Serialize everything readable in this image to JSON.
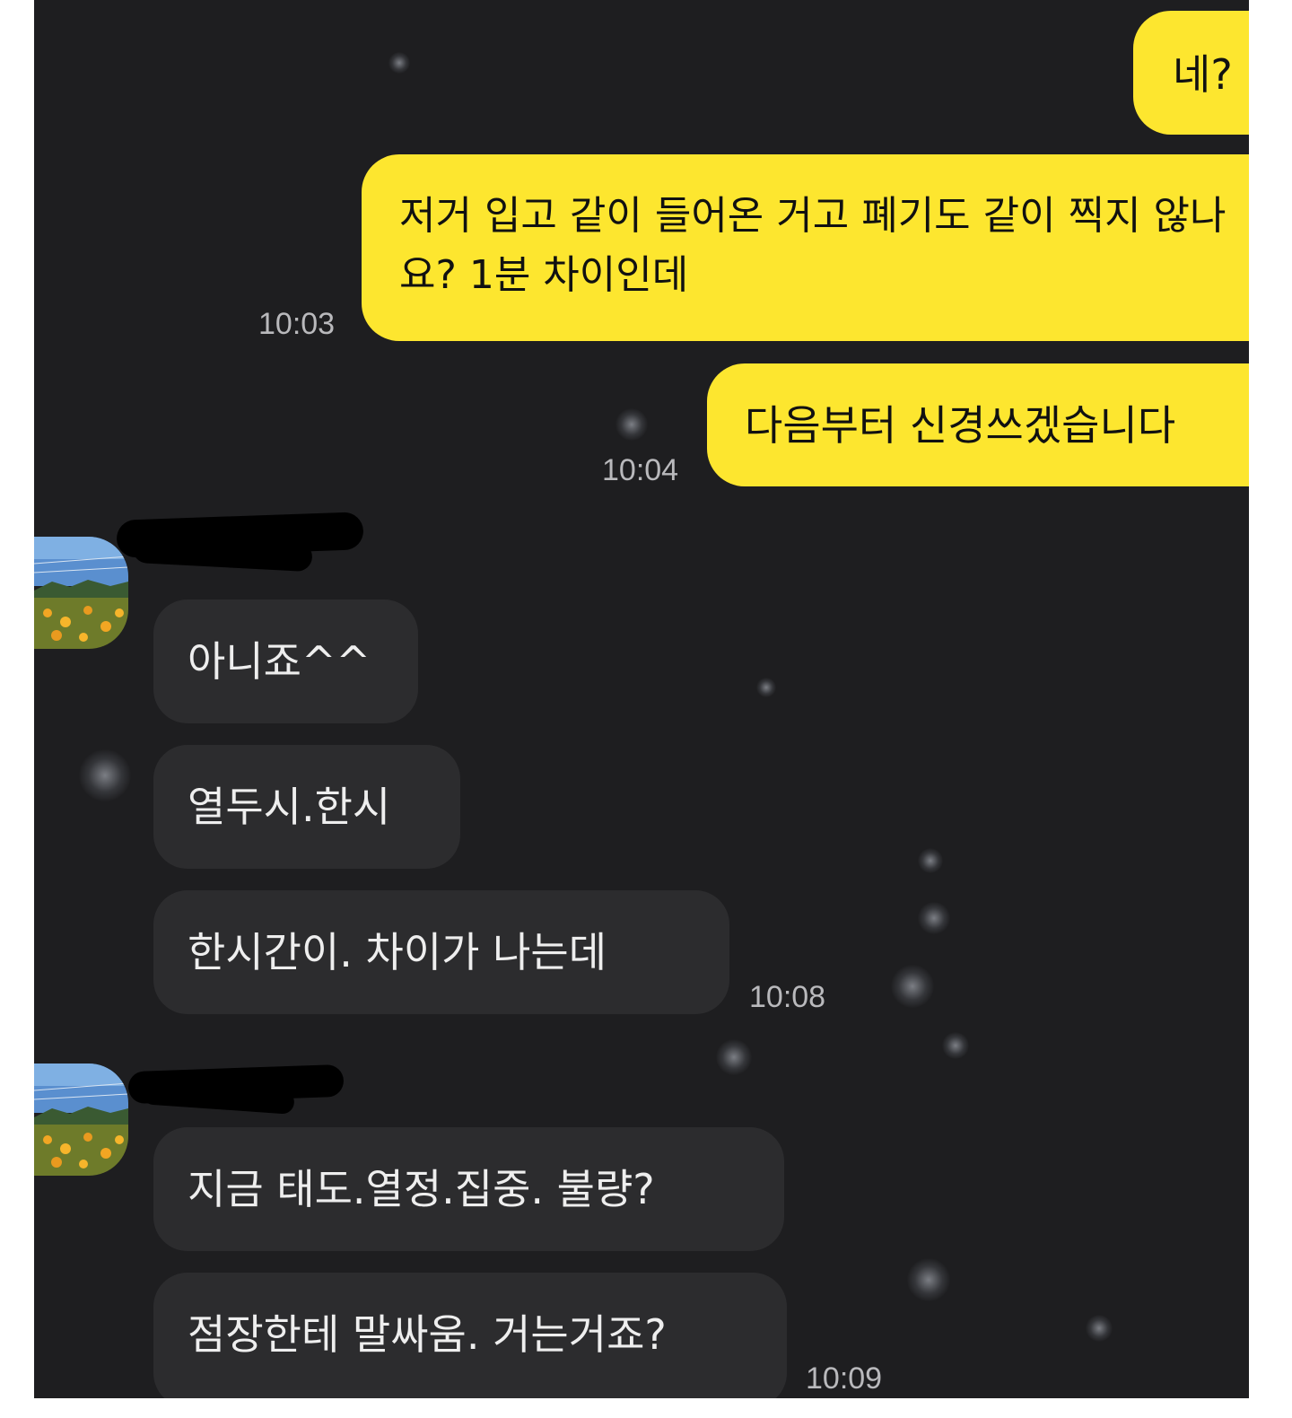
{
  "chat": {
    "messages": [
      {
        "sender": "me",
        "text": "네?",
        "time": ""
      },
      {
        "sender": "me",
        "text": "저거 입고 같이 들어온 거고 폐기도 같이 찍지 않나요? 1분 차이인데",
        "time": "10:03"
      },
      {
        "sender": "me",
        "text": "다음부터 신경쓰겠습니다",
        "time": "10:04"
      },
      {
        "sender": "them",
        "text": "아니죠^^",
        "time": ""
      },
      {
        "sender": "them",
        "text": "열두시.한시",
        "time": ""
      },
      {
        "sender": "them",
        "text": "한시간이.  차이가  나는데",
        "time": "10:08"
      },
      {
        "sender": "them",
        "text": "지금  태도.열정.집중.  불량?",
        "time": ""
      },
      {
        "sender": "them",
        "text": "점장한테  말싸움. 거는거죠?",
        "time": "10:09"
      }
    ]
  },
  "colors": {
    "background": "#1e1e20",
    "my_bubble": "#fde62f",
    "their_bubble": "#2c2c2e",
    "time_text": "#b9b9bc"
  }
}
